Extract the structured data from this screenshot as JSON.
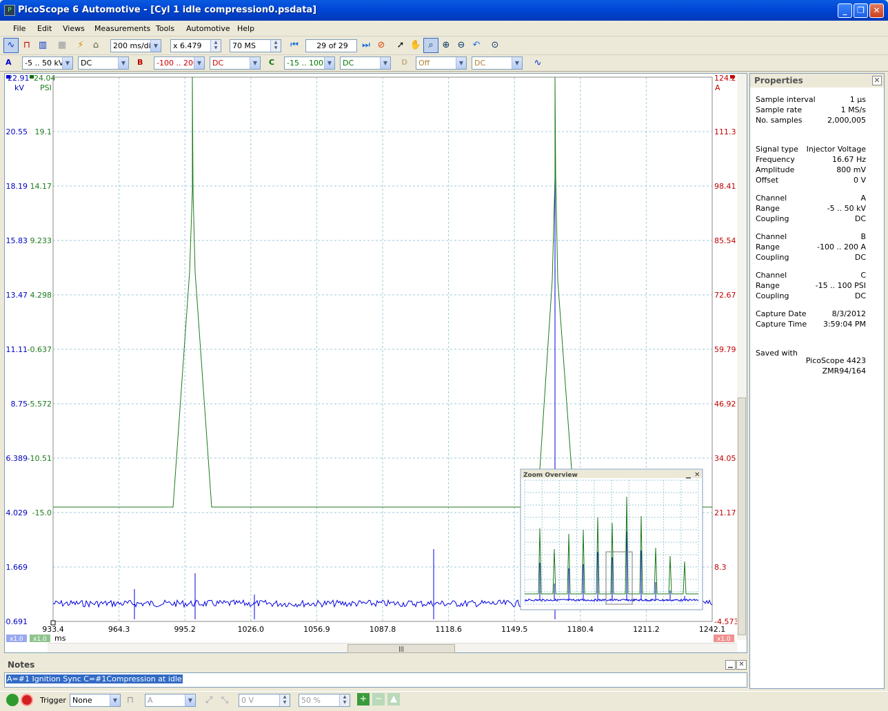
{
  "window": {
    "title": "PicoScope 6 Automotive - [Cyl 1 idle compression0.psdata]",
    "icon_label": "P"
  },
  "menu": [
    "File",
    "Edit",
    "Views",
    "Measurements",
    "Tools",
    "Automotive",
    "Help"
  ],
  "toolbar": {
    "timebase": "200 ms/div",
    "zoom": "x 6.479",
    "samples": "70 MS",
    "buffer": "29",
    "buffer_of": "of 29"
  },
  "channels": [
    {
      "letter": "A",
      "range": "-5 .. 50 kV",
      "coupling": "DC",
      "color": "#0000d0"
    },
    {
      "letter": "B",
      "range": "-100 .. 200 A",
      "coupling": "DC",
      "color": "#c00000"
    },
    {
      "letter": "C",
      "range": "-15 .. 100 PSI",
      "coupling": "DC",
      "color": "#007000"
    },
    {
      "letter": "D",
      "range": "Off",
      "coupling": "DC",
      "color": "#b09050"
    }
  ],
  "axes": {
    "a_unit": "kV",
    "c_unit": "PSI",
    "b_unit": "A",
    "x_unit": "ms",
    "a_top": "22.91",
    "c_top": "24.04",
    "b_top": "124.2",
    "a_ticks": [
      "20.55",
      "18.19",
      "15.83",
      "13.47",
      "11.11",
      "8.75",
      "6.389",
      "4.029",
      "1.669",
      "-0.691"
    ],
    "c_ticks": [
      "19.1",
      "14.17",
      "9.233",
      "4.298",
      "-0.637",
      "-5.572",
      "-10.51",
      "-15.0"
    ],
    "b_ticks": [
      "111.3",
      "98.41",
      "85.54",
      "72.67",
      "59.79",
      "46.92",
      "34.05",
      "21.17",
      "8.3",
      "-4.573"
    ],
    "x_ticks": [
      "933.4",
      "964.3",
      "995.2",
      "1026.0",
      "1056.9",
      "1087.8",
      "1118.6",
      "1149.5",
      "1180.4",
      "1211.2",
      "1242.1"
    ],
    "scale_a": "x1.0",
    "scale_c": "x1.0",
    "scale_b": "x1.0"
  },
  "zoom_overview": {
    "title": "Zoom Overview"
  },
  "properties": {
    "title": "Properties",
    "rows": [
      {
        "k": "Sample interval",
        "v": "1 µs"
      },
      {
        "k": "Sample rate",
        "v": "1 MS/s"
      },
      {
        "k": "No. samples",
        "v": "2,000,005"
      },
      {
        "k": "Signal type",
        "v": "Injector Voltage"
      },
      {
        "k": "Frequency",
        "v": "16.67 Hz"
      },
      {
        "k": "Amplitude",
        "v": "800 mV"
      },
      {
        "k": "Offset",
        "v": "0 V"
      },
      {
        "k": "Channel",
        "v": "A"
      },
      {
        "k": "Range",
        "v": "-5 .. 50 kV"
      },
      {
        "k": "Coupling",
        "v": "DC"
      },
      {
        "k": "Channel",
        "v": "B"
      },
      {
        "k": "Range",
        "v": "-100 .. 200 A"
      },
      {
        "k": "Coupling",
        "v": "DC"
      },
      {
        "k": "Channel",
        "v": "C"
      },
      {
        "k": "Range",
        "v": "-15 .. 100 PSI"
      },
      {
        "k": "Coupling",
        "v": "DC"
      },
      {
        "k": "Capture Date",
        "v": "8/3/2012"
      },
      {
        "k": "Capture Time",
        "v": "3:59:04 PM"
      },
      {
        "k": "Saved with",
        "v": ""
      }
    ],
    "saved_with_1": "PicoScope 4423",
    "saved_with_2": "ZMR94/164"
  },
  "notes": {
    "title": "Notes",
    "text": "A=#1 Ignition Sync C=#1Compression at idle"
  },
  "status": {
    "trigger_label": "Trigger",
    "trigger_mode": "None",
    "trigger_channel": "A",
    "trigger_level": "0 V",
    "trigger_pre": "50 %"
  },
  "colors": {
    "channel_a": "#0000e0",
    "channel_b": "#c00000",
    "channel_c": "#1a7a1a",
    "grid": "#9cc8d8"
  }
}
